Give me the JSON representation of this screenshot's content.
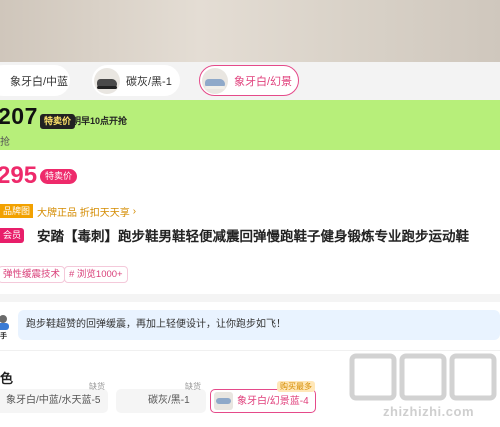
{
  "colorChips": [
    {
      "label": "象牙白/中蓝"
    },
    {
      "label": "碳灰/黑-1"
    },
    {
      "label": "象牙白/幻景"
    }
  ],
  "promo": {
    "price": "207",
    "tag": "特卖价",
    "time": "明早10点开抢",
    "subtext": "抢"
  },
  "price2": {
    "price": "295",
    "tag": "特卖价"
  },
  "brand": {
    "label": "品牌图",
    "text": "大牌正品 折扣天天享",
    "arrow": "›"
  },
  "title": {
    "tag": "会员",
    "text": "安踏【毒刺】跑步鞋男鞋轻便减震回弹慢跑鞋子健身锻炼专业跑步运动鞋"
  },
  "pills": [
    "弹性缓震技术",
    "# 浏览1000+"
  ],
  "tip": {
    "avatarLabel": "手",
    "text": "跑步鞋超赞的回弹缓震，再加上轻便设计，让你跑步如飞！"
  },
  "section": {
    "title": "色"
  },
  "options": [
    {
      "label": "象牙白/中蓝/水天蓝-5",
      "badge": "缺货"
    },
    {
      "label": "碳灰/黑-1",
      "badge": "缺货"
    },
    {
      "label": "象牙白/幻景蓝-4",
      "badge": "购买最多"
    }
  ],
  "watermark": {
    "text": "zhizhizhi.com"
  },
  "colors": {
    "accent": "#e54a8a",
    "green": "#b7ef7a",
    "pink": "#ee2a6b"
  }
}
